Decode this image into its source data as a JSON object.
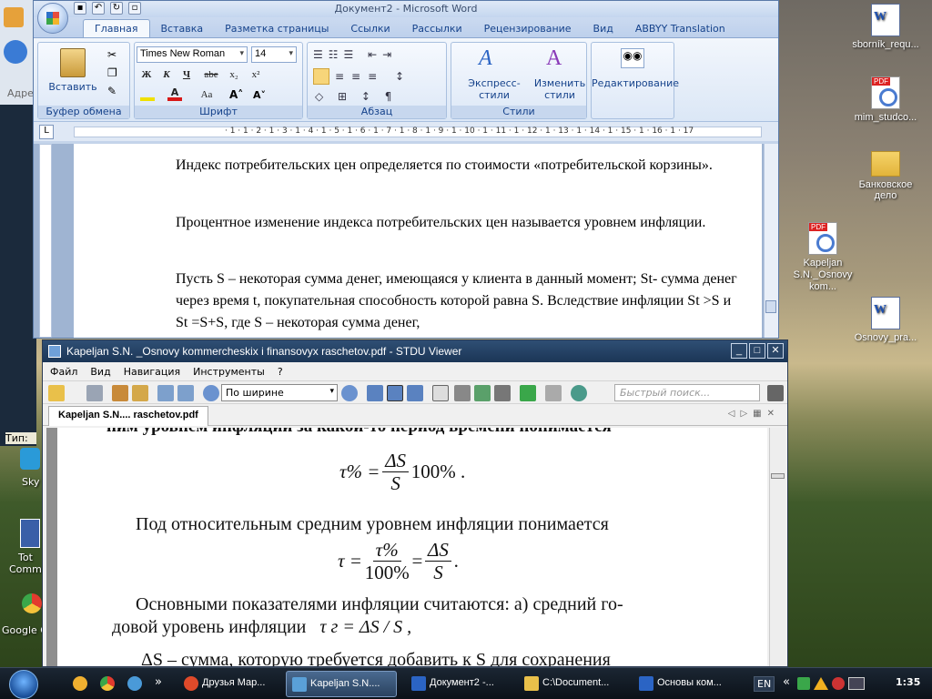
{
  "desktop": {
    "icons": [
      {
        "label": "sborník_requ...",
        "type": "doc"
      },
      {
        "label": "mim_studco...",
        "type": "pdf"
      },
      {
        "label": "Банковское дело",
        "type": "folder"
      },
      {
        "label": "Kapeljan S.N._Osnovy kom...",
        "type": "pdf"
      },
      {
        "label": "Osnovy_pra...",
        "type": "doc"
      }
    ],
    "left_icons": [
      {
        "label": "Sky"
      },
      {
        "label": "Tot Comma"
      },
      {
        "label": "Google C"
      }
    ],
    "left_fragments": {
      "address": "Адре",
      "tip": "Тип:"
    }
  },
  "word": {
    "title": "Документ2 - Microsoft Word",
    "tabs": [
      "Главная",
      "Вставка",
      "Разметка страницы",
      "Ссылки",
      "Рассылки",
      "Рецензирование",
      "Вид",
      "ABBYY Translation"
    ],
    "active_tab": "Главная",
    "groups": {
      "clipboard": "Буфер обмена",
      "font": "Шрифт",
      "paragraph": "Абзац",
      "styles": "Стили"
    },
    "paste_label": "Вставить",
    "font_name": "Times New Roman",
    "font_size": "14",
    "font_buttons": [
      "Ж",
      "К",
      "Ч",
      "abe",
      "x₂",
      "x²",
      "Aa"
    ],
    "express_styles": "Экспресс-стили",
    "change_styles": "Изменить стили",
    "editing": "Редактирование",
    "ruler_numbers": "· 1 · 1 · 2 · 1 · 3 · 1 · 4 · 1 · 5 · 1 · 6 · 1 · 7 · 1 · 8 · 1 · 9 · 1 · 10 · 1 · 11 · 1 · 12 · 1 · 13 · 1 · 14 · 1 · 15 · 1 · 16 · 1 · 17",
    "paragraphs": [
      "Индекс потребительских цен определяется по стоимости «потребительской корзины».",
      "Процентное изменение индекса потребительских цен называется уровнем инфляции.",
      " Пусть S – некоторая сумма денег, имеющаяся у клиента в данный момент; St- сумма денег через время t, покупательная способность которой равна  S. Вследствие инфляции St >S и  St =S+S, где S – некоторая сумма денег,"
    ]
  },
  "stdu": {
    "title": "Kapeljan S.N. _Osnovy kommercheskix i finansovyx raschetov.pdf - STDU Viewer",
    "menu": [
      "Файл",
      "Вид",
      "Навигация",
      "Инструменты",
      "?"
    ],
    "zoom": "По ширине",
    "search_placeholder": "Быстрый поиск...",
    "doc_tab": "Kapeljan S.N.... raschetov.pdf",
    "page": {
      "top_cut": "ним уровнем инфляции за какой-то период времени понимается",
      "formula1_lhs": "τ% =",
      "formula1_num": "ΔS",
      "formula1_den": "S",
      "formula1_rhs": "100% .",
      "para2": "Под относительным средним уровнем инфляции понимается",
      "formula2_lhs": "τ =",
      "formula2_num1": "τ%",
      "formula2_den1": "100%",
      "formula2_eq": "=",
      "formula2_num2": "ΔS",
      "formula2_den2": "S",
      "formula2_end": ".",
      "para3_line1": "Основными показателями инфляции считаются: а) средний го-",
      "para3_line2_a": "довой уровень инфляции",
      "para3_line2_formula": "τ г = ΔS / S ,",
      "para4_cut": "ΔS – сумма, которую требуется добавить к S для сохранения"
    }
  },
  "taskbar": {
    "items": [
      {
        "label": "Друзья Мар...",
        "active": false,
        "color": "#e04a2a"
      },
      {
        "label": "Kapeljan S.N....",
        "active": true,
        "color": "#5aa0d8"
      },
      {
        "label": "Документ2 -...",
        "active": false,
        "color": "#2b64c4"
      },
      {
        "label": "C:\\Document...",
        "active": false,
        "color": "#e9c04a"
      },
      {
        "label": "Основы ком...",
        "active": false,
        "color": "#2b64c4"
      }
    ],
    "lang": "EN",
    "time": "1:35"
  }
}
